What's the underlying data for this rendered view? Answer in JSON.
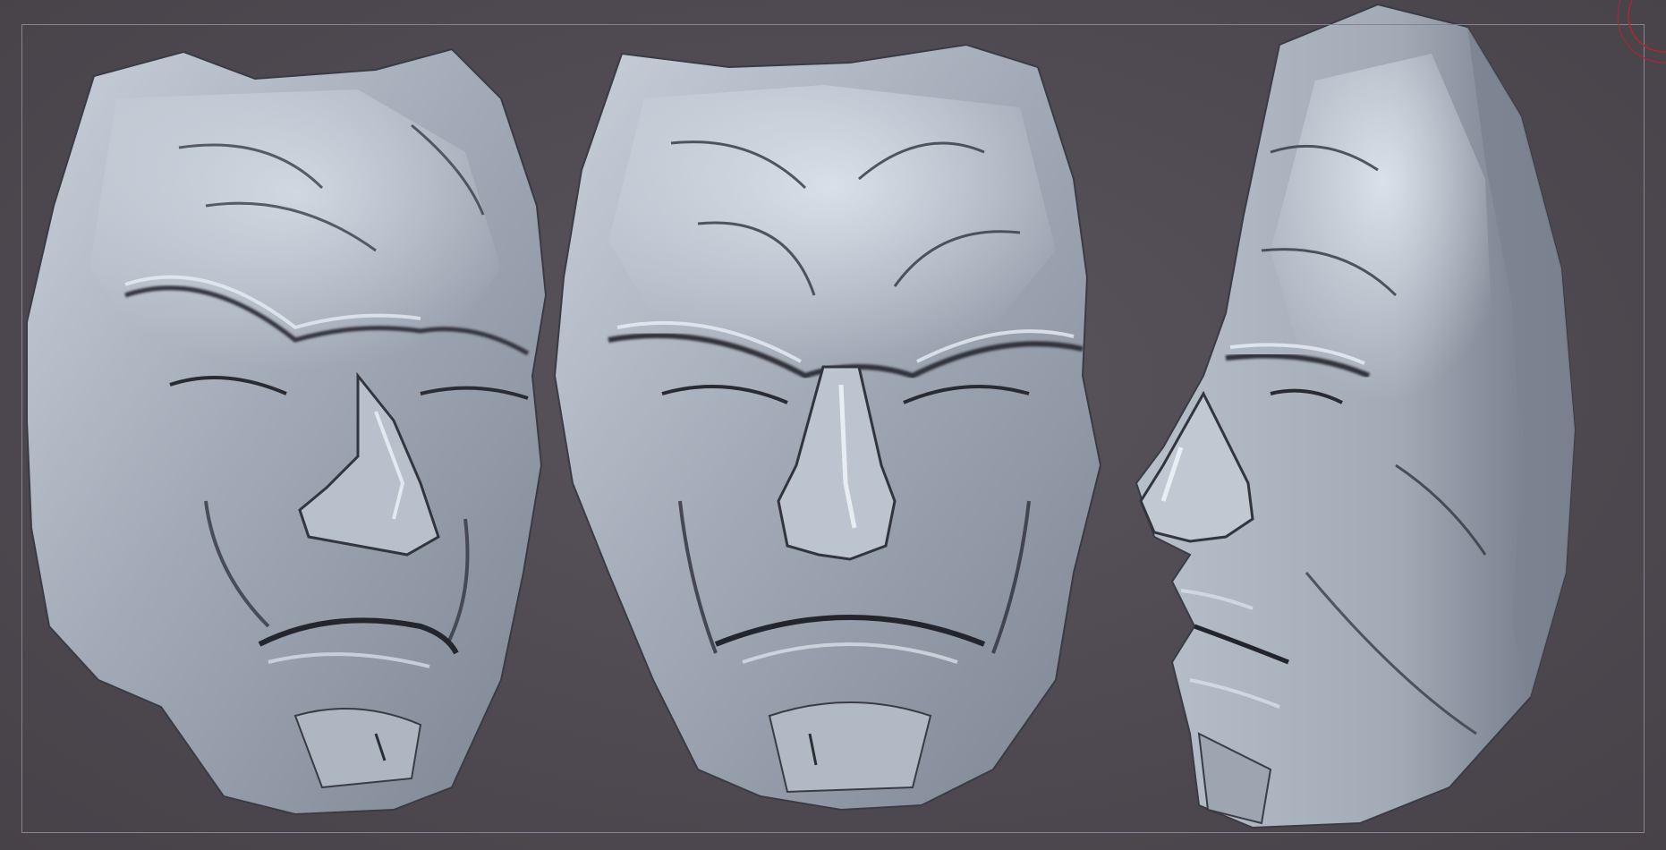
{
  "canvas": {
    "background": "#4f4a51",
    "frame_color": "#8a8290",
    "clay_color": "#a9b1bd",
    "highlight_color": "#eef3fa",
    "shadow_color": "#2f3038"
  },
  "model": {
    "views": [
      {
        "name": "three-quarter"
      },
      {
        "name": "front"
      },
      {
        "name": "side"
      }
    ]
  },
  "gizmo": {
    "color": "#b3262e"
  }
}
